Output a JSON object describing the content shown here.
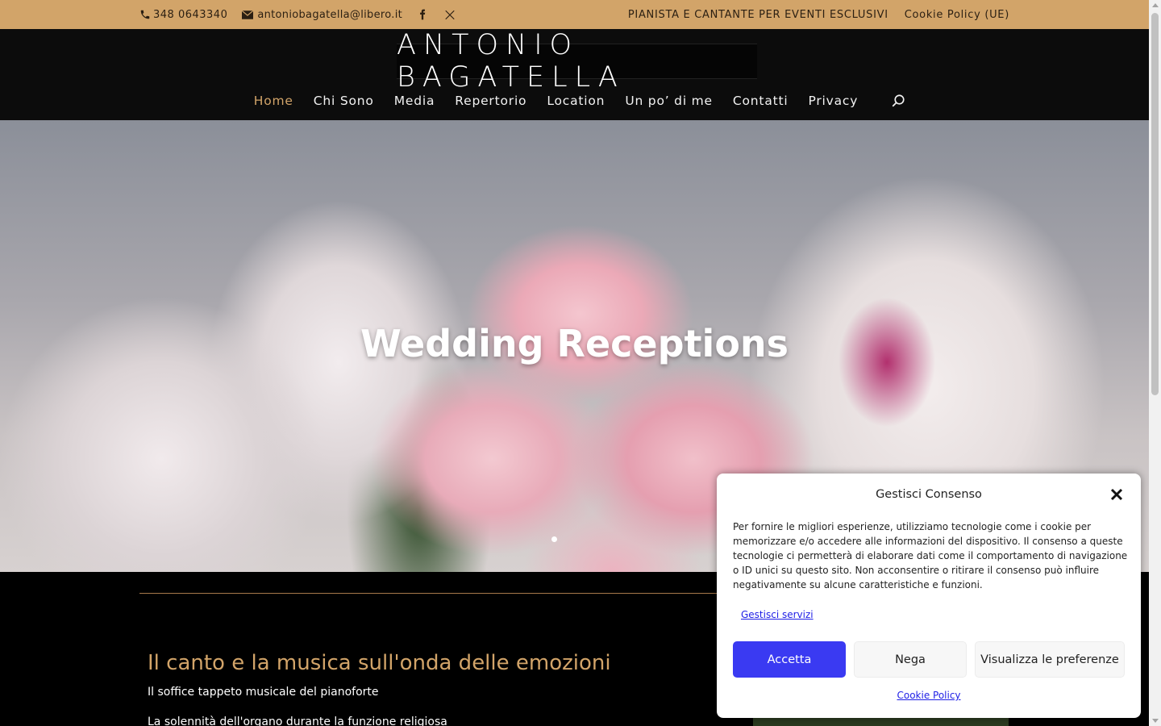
{
  "topbar": {
    "phone": "348 0643340",
    "email": "antoniobagatella@libero.it",
    "social_icons": [
      "facebook-icon",
      "x-icon"
    ],
    "tagline": "PIANISTA E CANTANTE PER EVENTI ESCLUSIVI",
    "cookie_link": "Cookie Policy (UE)"
  },
  "header": {
    "logo_text": "ANTONIO BAGATELLA",
    "nav": [
      {
        "label": "Home",
        "active": true
      },
      {
        "label": "Chi Sono"
      },
      {
        "label": "Media"
      },
      {
        "label": "Repertorio"
      },
      {
        "label": "Location"
      },
      {
        "label": "Un po’ di me"
      },
      {
        "label": "Contatti"
      },
      {
        "label": "Privacy"
      }
    ]
  },
  "hero": {
    "title": "Wedding Receptions"
  },
  "content": {
    "heading": "Il canto e la musica sull'onda delle emozioni",
    "p1": "Il soffice tappeto musicale del pianoforte",
    "p2": "La solennità dell'organo durante la funzione religiosa"
  },
  "consent": {
    "title": "Gestisci Consenso",
    "text": "Per fornire le migliori esperienze, utilizziamo tecnologie come i cookie per memorizzare e/o accedere alle informazioni del dispositivo. Il consenso a queste tecnologie ci permetterà di elaborare dati come il comportamento di navigazione o ID unici su questo sito. Non acconsentire o ritirare il consenso può influire negativamente su alcune caratteristiche e funzioni.",
    "manage_services": "Gestisci servizi",
    "accept": "Accetta",
    "deny": "Nega",
    "preferences": "Visualizza le preferenze",
    "policy": "Cookie Policy"
  },
  "colors": {
    "accent": "#d2a469",
    "topbar_bg": "#d2a469",
    "header_bg": "#0c0c0c",
    "accept_button": "#3a3af2"
  }
}
